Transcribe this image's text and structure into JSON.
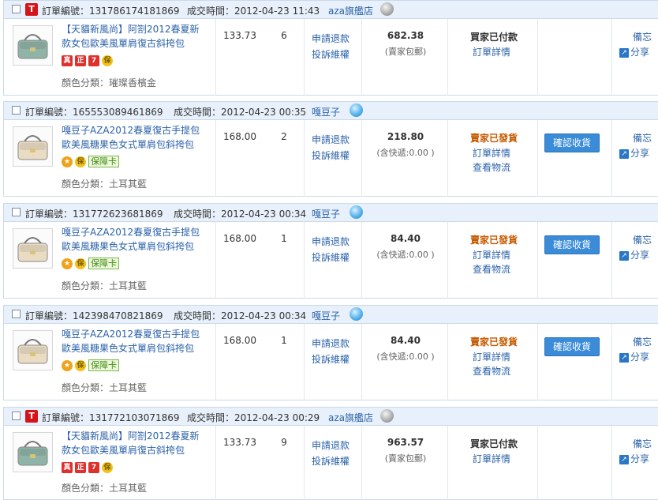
{
  "labels": {
    "order_no": "訂單編號：",
    "deal_time": "成交時間：",
    "color_attr_prefix": "顏色分類："
  },
  "orders": [
    {
      "store_type": "T",
      "order_id": "131786174181869",
      "deal_time": "2012-04-23 11:43",
      "seller": "aza旗艦店",
      "seller_online": false,
      "title": "【天貓新風尚】阿劄2012春夏新款女包歐美風單肩復古斜挎包",
      "badges": [
        "真",
        "正",
        "7",
        "保"
      ],
      "color_attr": "璀璨香檳金",
      "price": "133.73",
      "qty": "6",
      "refund": "申請退款",
      "complaint": "投訴維權",
      "total": "682.38",
      "shipping": "(賣家包郵)",
      "status": "買家已付款",
      "status_color": "#333333",
      "detail": "訂單詳情",
      "logistics": "",
      "confirm": "",
      "memo": "備忘",
      "share": "分享",
      "bag_color": "#8fb3a7"
    },
    {
      "store_type": "",
      "order_id": "165553089461869",
      "deal_time": "2012-04-23 00:35",
      "seller": "嘎豆子",
      "seller_online": true,
      "title": "嘎豆子AZA2012春夏復古手提包歐美風糖果色女式單肩包斜挎包",
      "badges": [
        "★",
        "保"
      ],
      "guarantee": "保障卡",
      "color_attr": "土耳其藍",
      "price": "168.00",
      "qty": "2",
      "refund": "申請退款",
      "complaint": "投訴維權",
      "total": "218.80",
      "shipping": "(含快遞:0.00 )",
      "status": "賣家已發貨",
      "status_color": "#c65a00",
      "detail": "訂單詳情",
      "logistics": "查看物流",
      "confirm": "確認收貨",
      "memo": "備忘",
      "share": "分享",
      "bag_color": "#e9dcc3"
    },
    {
      "store_type": "",
      "order_id": "131772623681869",
      "deal_time": "2012-04-23 00:34",
      "seller": "嘎豆子",
      "seller_online": true,
      "title": "嘎豆子AZA2012春夏復古手提包歐美風糖果色女式單肩包斜挎包",
      "badges": [
        "★",
        "保"
      ],
      "guarantee": "保障卡",
      "color_attr": "土耳其藍",
      "price": "168.00",
      "qty": "1",
      "refund": "申請退款",
      "complaint": "投訴維權",
      "total": "84.40",
      "shipping": "(含快遞:0.00 )",
      "status": "賣家已發貨",
      "status_color": "#c65a00",
      "detail": "訂單詳情",
      "logistics": "查看物流",
      "confirm": "確認收貨",
      "memo": "備忘",
      "share": "分享",
      "bag_color": "#e9dcc3"
    },
    {
      "store_type": "",
      "order_id": "142398470821869",
      "deal_time": "2012-04-23 00:34",
      "seller": "嘎豆子",
      "seller_online": true,
      "title": "嘎豆子AZA2012春夏復古手提包歐美風糖果色女式單肩包斜挎包",
      "badges": [
        "★",
        "保"
      ],
      "guarantee": "保障卡",
      "color_attr": "土耳其藍",
      "price": "168.00",
      "qty": "1",
      "refund": "申請退款",
      "complaint": "投訴維權",
      "total": "84.40",
      "shipping": "(含快遞:0.00 )",
      "status": "賣家已發貨",
      "status_color": "#c65a00",
      "detail": "訂單詳情",
      "logistics": "查看物流",
      "confirm": "確認收貨",
      "memo": "備忘",
      "share": "分享",
      "bag_color": "#e9dcc3"
    },
    {
      "store_type": "T",
      "order_id": "131772103071869",
      "deal_time": "2012-04-23 00:29",
      "seller": "aza旗艦店",
      "seller_online": false,
      "title": "【天貓新風尚】阿劄2012春夏新款女包歐美風單肩復古斜挎包",
      "badges": [
        "真",
        "正",
        "7",
        "保"
      ],
      "color_attr": "土耳其藍",
      "price": "133.73",
      "qty": "9",
      "refund": "申請退款",
      "complaint": "投訴維權",
      "total": "963.57",
      "shipping": "(賣家包郵)",
      "status": "買家已付款",
      "status_color": "#333333",
      "detail": "訂單詳情",
      "logistics": "",
      "confirm": "",
      "memo": "備忘",
      "share": "分享",
      "bag_color": "#8fb3a7"
    }
  ]
}
